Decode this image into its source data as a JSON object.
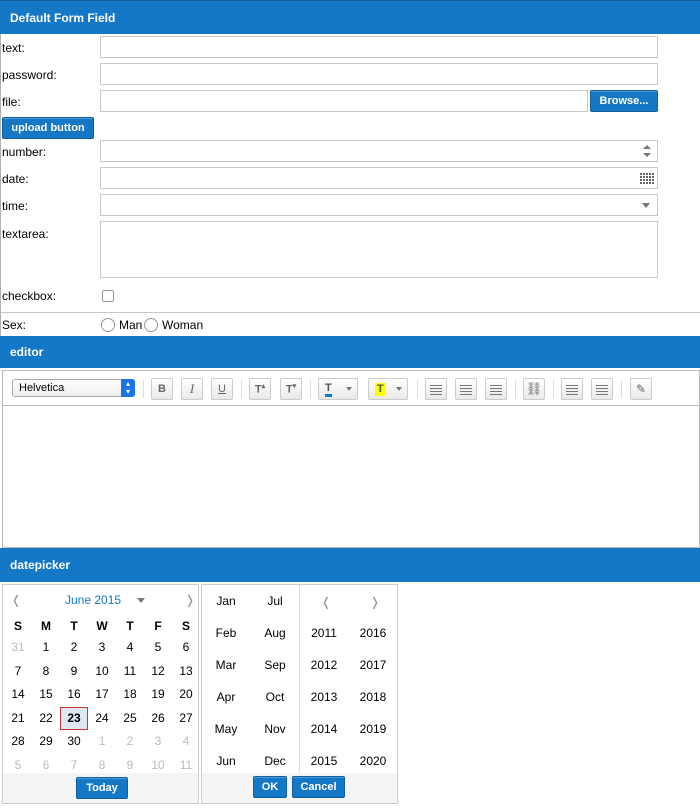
{
  "sections": {
    "form_title": "Default Form Field",
    "editor_title": "editor",
    "datepicker_title": "datepicker"
  },
  "form": {
    "text_label": "text:",
    "password_label": "password:",
    "file_label": "file:",
    "browse_label": "Browse...",
    "upload_label": "upload button",
    "number_label": "number:",
    "date_label": "date:",
    "time_label": "time:",
    "textarea_label": "textarea:",
    "checkbox_label": "checkbox:",
    "sex_label": "Sex:",
    "sex_options": [
      "Man",
      "Woman"
    ]
  },
  "editor": {
    "font_value": "Helvetica",
    "text_color_label": "T",
    "highlight_label": "T",
    "highlight_color": "#ffff00",
    "text_color_bar": "#1578c6"
  },
  "datepicker": {
    "month_title": "June 2015",
    "prev": "❬",
    "next": "❭",
    "weekdays": [
      "S",
      "M",
      "T",
      "W",
      "T",
      "F",
      "S"
    ],
    "weeks": [
      [
        "31",
        "1",
        "2",
        "3",
        "4",
        "5",
        "6"
      ],
      [
        "7",
        "8",
        "9",
        "10",
        "11",
        "12",
        "13"
      ],
      [
        "14",
        "15",
        "16",
        "17",
        "18",
        "19",
        "20"
      ],
      [
        "21",
        "22",
        "23",
        "24",
        "25",
        "26",
        "27"
      ],
      [
        "28",
        "29",
        "30",
        "1",
        "2",
        "3",
        "4"
      ],
      [
        "5",
        "6",
        "7",
        "8",
        "9",
        "10",
        "11"
      ]
    ],
    "selected_day": "23",
    "today_label": "Today",
    "months": [
      "Jan",
      "Jul",
      "Feb",
      "Aug",
      "Mar",
      "Sep",
      "Apr",
      "Oct",
      "May",
      "Nov",
      "Jun",
      "Dec"
    ],
    "years": [
      "2011",
      "2016",
      "2012",
      "2017",
      "2013",
      "2018",
      "2014",
      "2019",
      "2015",
      "2020"
    ],
    "ok_label": "OK",
    "cancel_label": "Cancel"
  },
  "colors": {
    "accent": "#1578c6"
  }
}
